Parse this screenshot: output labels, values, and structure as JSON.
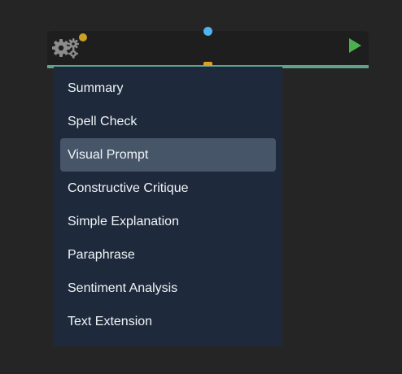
{
  "node": {
    "settings_icon": "gears-icon",
    "run_icon": "play-icon",
    "colors": {
      "accent": "#5fa38e",
      "status_dot": "#c9a227",
      "input_handle": "#4fb3f0",
      "output_handle": "#e0a020",
      "run": "#4caf50"
    }
  },
  "menu": {
    "selected_index": 2,
    "items": [
      {
        "label": "Summary"
      },
      {
        "label": "Spell Check"
      },
      {
        "label": "Visual Prompt"
      },
      {
        "label": "Constructive Critique"
      },
      {
        "label": "Simple Explanation"
      },
      {
        "label": "Paraphrase"
      },
      {
        "label": "Sentiment Analysis"
      },
      {
        "label": "Text Extension"
      }
    ]
  }
}
